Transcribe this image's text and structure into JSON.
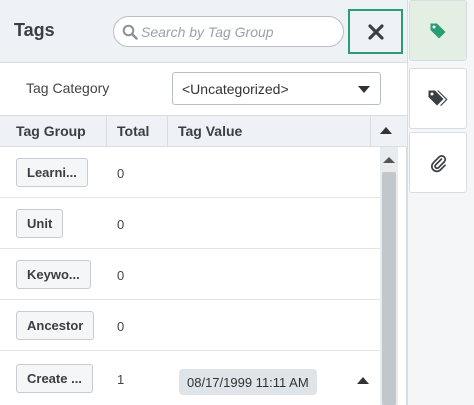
{
  "header": {
    "title": "Tags",
    "search_placeholder": "Search by Tag Group"
  },
  "category": {
    "label": "Tag Category",
    "selected": "<Uncategorized>"
  },
  "table": {
    "columns": [
      "Tag Group",
      "Total",
      "Tag Value"
    ],
    "rows": [
      {
        "group": "Learni...",
        "total": "0",
        "value": ""
      },
      {
        "group": "Unit",
        "total": "0",
        "value": ""
      },
      {
        "group": "Keywo...",
        "total": "0",
        "value": ""
      },
      {
        "group": "Ancestor",
        "total": "0",
        "value": ""
      },
      {
        "group": "Create ...",
        "total": "1",
        "value": "08/17/1999 11:11 AM"
      }
    ]
  },
  "rail": {
    "items": [
      {
        "icon": "tag-icon",
        "active": true
      },
      {
        "icon": "tags-icon",
        "active": false
      },
      {
        "icon": "paperclip-icon",
        "active": false
      }
    ]
  },
  "colors": {
    "accent": "#2a9d74",
    "active_tab_bg": "#e3efe2",
    "header_bg": "#eef1f5"
  }
}
